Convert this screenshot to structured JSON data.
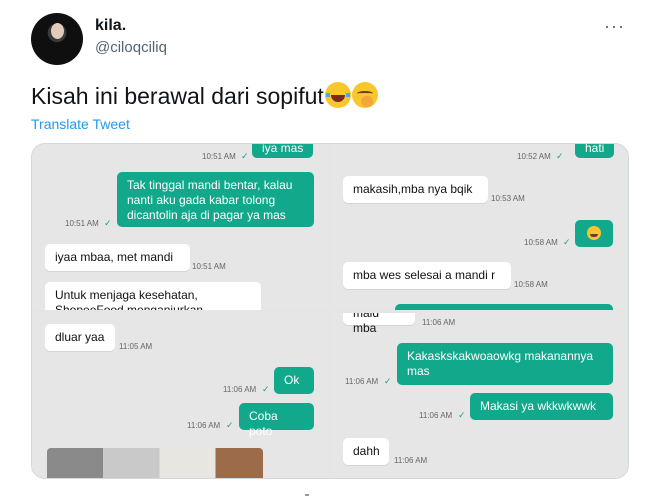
{
  "header": {
    "name": "kila.",
    "handle": "@ciloqciliq",
    "more_label": "···"
  },
  "tweet": {
    "text": "Kisah ini berawal dari sopifut",
    "translate_label": "Translate Tweet"
  },
  "chat": {
    "p1": {
      "cut_bubble": "iya mas",
      "cut_time": "10:51 AM",
      "out_msg": "Tak tinggal mandi bentar, kalau nanti aku gada kabar tolong dicantolin aja di pagar ya mas",
      "out_time": "10:51 AM",
      "in_msg": "iyaa mbaa, met mandi",
      "in_time": "10:51 AM",
      "promo": "Untuk menjaga kesehatan, ShopeeFood menganjurkan"
    },
    "p2": {
      "cut_bubble": "hati",
      "cut_time": "10:52 AM",
      "in_msg": "makasih,mba nya bqik",
      "in_time": "10:53 AM",
      "emoji_time": "10:58 AM",
      "in_msg2": "mba wes selesai a mandi r",
      "in_time2": "10:58 AM"
    },
    "p3": {
      "in_msg": "dluar yaa",
      "in_time": "11:05 AM",
      "out_msg": "Ok",
      "out_time": "11:06 AM",
      "out_msg2": "Coba poto",
      "out_time2": "11:06 AM"
    },
    "p4": {
      "cut_in": "maid mba",
      "cut_time": "11:06 AM",
      "out_msg": "Kakaskskakwoaowkg makanannya mas",
      "out_time": "11:06 AM",
      "out_msg2": "Makasi ya wkkwkwwk",
      "out_time2": "11:06 AM",
      "in_msg": "dahh",
      "in_time": "11:06 AM"
    }
  }
}
